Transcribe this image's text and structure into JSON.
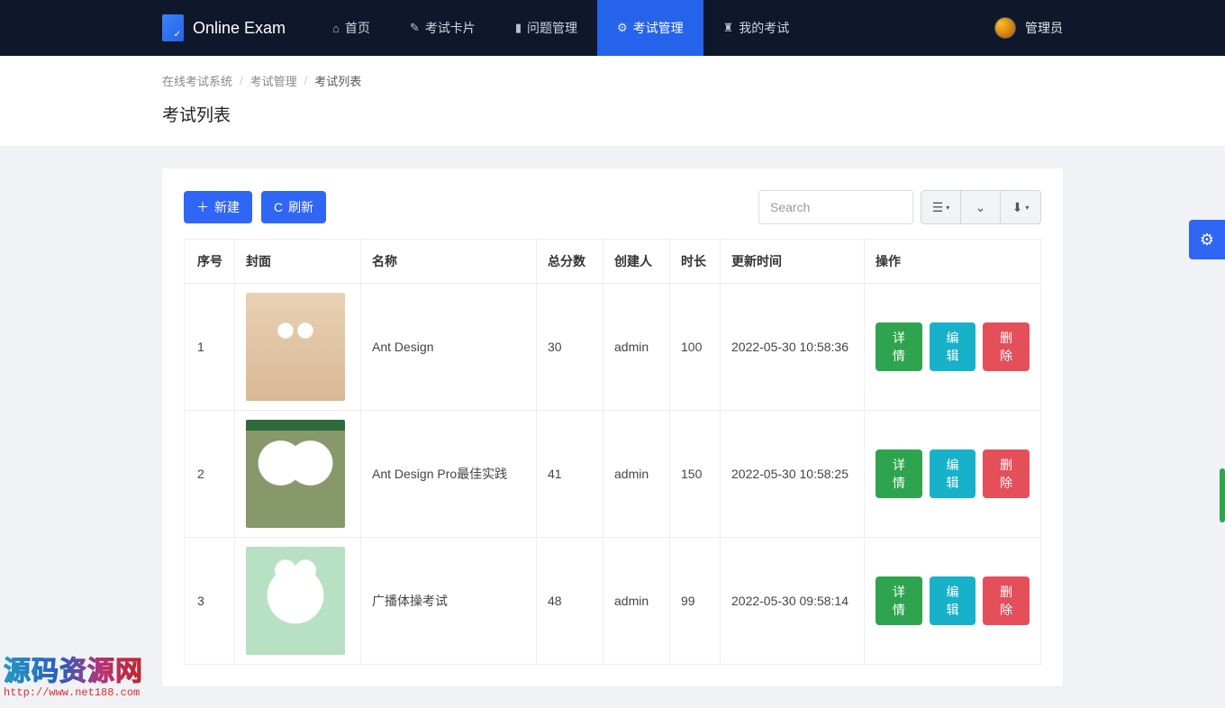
{
  "brand": {
    "name": "Online Exam"
  },
  "nav": {
    "items": [
      {
        "icon": "⌂",
        "label": "首页"
      },
      {
        "icon": "✎",
        "label": "考试卡片"
      },
      {
        "icon": "▮",
        "label": "问题管理"
      },
      {
        "icon": "⚙",
        "label": "考试管理",
        "active": true
      },
      {
        "icon": "♜",
        "label": "我的考试"
      }
    ]
  },
  "user": {
    "name": "管理员"
  },
  "breadcrumb": {
    "items": [
      "在线考试系统",
      "考试管理",
      "考试列表"
    ]
  },
  "page": {
    "title": "考试列表"
  },
  "toolbar": {
    "new_label": "新建",
    "refresh_label": "刷新",
    "search_placeholder": "Search"
  },
  "columns": {
    "index": "序号",
    "cover": "封面",
    "name": "名称",
    "total": "总分数",
    "creator": "创建人",
    "duration": "时长",
    "updated": "更新时间",
    "actions": "操作"
  },
  "actions": {
    "detail": "详情",
    "edit": "编辑",
    "delete": "删除"
  },
  "rows": [
    {
      "index": "1",
      "name": "Ant Design",
      "total": "30",
      "creator": "admin",
      "duration": "100",
      "updated": "2022-05-30 10:58:36"
    },
    {
      "index": "2",
      "name": "Ant Design Pro最佳实践",
      "total": "41",
      "creator": "admin",
      "duration": "150",
      "updated": "2022-05-30 10:58:25"
    },
    {
      "index": "3",
      "name": "广播体操考试",
      "total": "48",
      "creator": "admin",
      "duration": "99",
      "updated": "2022-05-30 09:58:14"
    }
  ],
  "watermark": {
    "title": "源码资源网",
    "url": "http://www.net188.com"
  }
}
